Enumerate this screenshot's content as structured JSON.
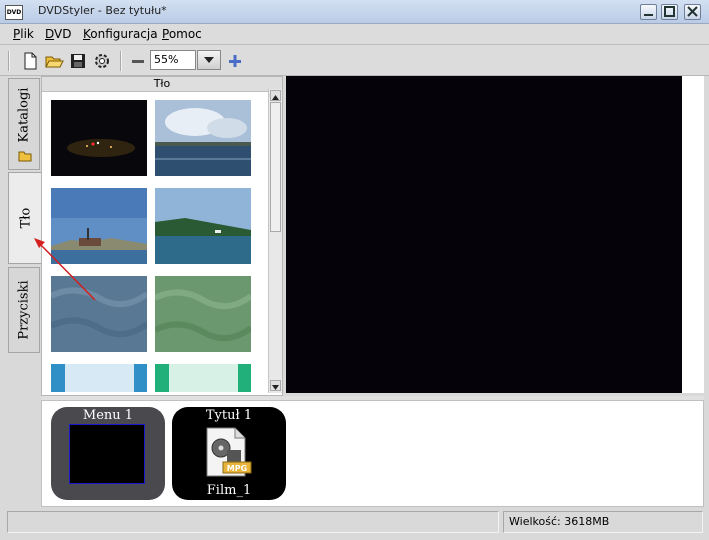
{
  "window": {
    "app_icon_text": "DVD",
    "title": "DVDStyler - Bez tytułu*"
  },
  "menubar": {
    "items": [
      {
        "label": "Plik",
        "mnemonic": "P",
        "rest": "lik"
      },
      {
        "label": "DVD",
        "mnemonic": "D",
        "rest": "VD"
      },
      {
        "label": "Konfiguracja",
        "mnemonic": "K",
        "rest": "onfiguracja"
      },
      {
        "label": "Pomoc",
        "mnemonic": "P",
        "rest": "omoc"
      }
    ]
  },
  "toolbar": {
    "zoom_value": "55%",
    "icons": [
      "new-file-icon",
      "open-folder-icon",
      "save-icon",
      "settings-icon",
      "zoom-out-icon",
      "dropdown-arrow-icon",
      "zoom-in-icon"
    ]
  },
  "side_tabs": {
    "katalogi": "Katalogi",
    "tlo": "Tło",
    "przyciski": "Przyciski"
  },
  "background_panel": {
    "header": "Tło",
    "thumbnails": [
      "night-road",
      "sea-clouds",
      "ship-harbour",
      "lake-shore",
      "blue-pattern",
      "green-pattern",
      "blue-stripe",
      "green-stripe"
    ]
  },
  "titleset": {
    "menu_card": {
      "title": "Menu 1"
    },
    "title_card": {
      "title": "Tytuł 1",
      "file_label": "Film_1",
      "icon_text": "MPG"
    }
  },
  "statusbar": {
    "left": "",
    "size_text": "Wielkość: 3618MB"
  },
  "colors": {
    "accent_arrow": "#d42020",
    "preview_bg": "#050309",
    "menu_card_bg": "#4a4a4e",
    "title_card_bg": "#000000",
    "menu_screen_border": "#1a1acc"
  }
}
